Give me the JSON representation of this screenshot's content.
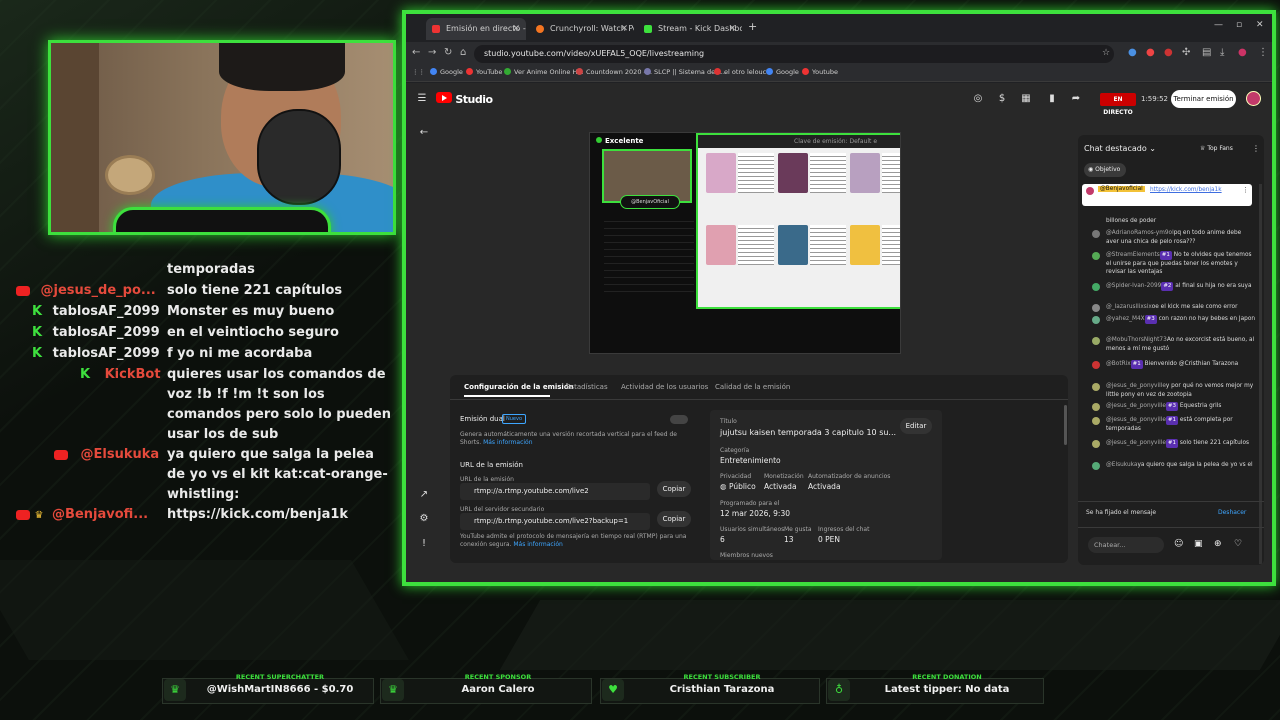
{
  "overlay_chat": [
    {
      "platform": "youtube",
      "user": "",
      "text": "temporadas",
      "user_color": "#e8e8e8"
    },
    {
      "platform": "youtube",
      "user": "@jesus_de_po...",
      "text": "solo tiene 221 capítulos",
      "user_color": "#e54a3c"
    },
    {
      "platform": "kick",
      "user": "tablosAF_2099",
      "text": "Monster es muy bueno",
      "user_color": "#e8e8e8"
    },
    {
      "platform": "kick",
      "user": "tablosAF_2099",
      "text": "en el veintiocho seguro",
      "user_color": "#e8e8e8"
    },
    {
      "platform": "kick",
      "user": "tablosAF_2099",
      "text": "f yo ni me acordaba",
      "user_color": "#e8e8e8"
    },
    {
      "platform": "kick",
      "user": "KickBot",
      "text": "quieres usar los comandos de voz !b !f !m !t son los comandos pero solo lo pueden usar los de sub",
      "user_color": "#e54a3c"
    },
    {
      "platform": "youtube",
      "user": "@Elsukuka",
      "text": "ya quiero que salga la pelea de yo vs el kit kat:cat-orange-whistling:",
      "user_color": "#e54a3c"
    },
    {
      "platform": "youtube",
      "user": "@Benjavofi...",
      "text": "https://kick.com/benja1k",
      "user_color": "#e54a3c"
    }
  ],
  "browser": {
    "tabs": [
      {
        "label": "Emisión en directo - YouTube S",
        "color": "#e33"
      },
      {
        "label": "Crunchyroll: Watch Popular An",
        "color": "#f47521"
      },
      {
        "label": "Stream - Kick Dashboard",
        "color": "#3de03d"
      }
    ],
    "url": "studio.youtube.com/video/xUEFAL5_OQE/livestreaming",
    "bookmarks": [
      "Google",
      "YouTube",
      "Ver Anime Online H...",
      "Countdown 2020 -...",
      "SLCP || Sistema de L...",
      "el otro lelouch",
      "Google",
      "Youtube"
    ]
  },
  "studio": {
    "brand": "Studio",
    "live_badge": "EN DIRECTO",
    "elapsed": "1:59:52",
    "end_button": "Terminar emisión",
    "preview_status": "Excelente",
    "stream_key_placeholder": "Clave de emisión: Default e",
    "preview_channel": "@BenjavOficial",
    "tabs": [
      "Configuración de la emisión",
      "Estadísticas",
      "Actividad de los usuarios",
      "Calidad de la emisión"
    ],
    "dual": {
      "label": "Emisión dual",
      "badge": "Nuevo",
      "desc": "Genera automáticamente una versión recortada vertical para el feed de Shorts.",
      "more": "Más información"
    },
    "url_section": "URL de la emisión",
    "url_label": "URL de la emisión",
    "url_value": "rtmp://a.rtmp.youtube.com/live2",
    "backup_label": "URL del servidor secundario",
    "backup_value": "rtmp://b.rtmp.youtube.com/live2?backup=1",
    "copy": "Copiar",
    "rtmp_note": "YouTube admite el protocolo de mensajería en tiempo real (RTMP) para una conexión segura.",
    "rtmp_more": "Más información",
    "details": {
      "title_label": "Título",
      "title": "jujutsu kaisen temporada 3 capitulo 10 su...",
      "edit": "Editar",
      "category_label": "Categoría",
      "category": "Entretenimiento",
      "privacy_label": "Privacidad",
      "privacy": "Público",
      "monet_label": "Monetización",
      "monet": "Activada",
      "auto_label": "Automatizador de anuncios",
      "auto": "Activada",
      "sched_label": "Programado para el",
      "sched": "12 mar 2026, 9:30",
      "viewers_label": "Usuarios simultáneos",
      "viewers": "6",
      "likes_label": "Me gusta",
      "likes": "13",
      "income_label": "Ingresos del chat",
      "income": "0 PEN",
      "members_label": "Miembros nuevos"
    }
  },
  "chat_panel": {
    "title": "Chat destacado",
    "top_fans": "Top Fans",
    "goal": "Objetivo",
    "pinned_user": "@Benjavoficial",
    "pinned_link": "https://kick.com/benja1k",
    "messages": [
      {
        "user": "",
        "text": "billones de poder",
        "badge": ""
      },
      {
        "user": "@AdrianoRamos-ym9ol",
        "text": "pq en todo anime debe aver una chica de pelo rosa???",
        "badge": ""
      },
      {
        "user": "@StreamElements",
        "text": "No te olvides que tenemos el unirse para que puedas tener los emotes y revisar las ventajas",
        "badge": "#1"
      },
      {
        "user": "@Spider-Ivan-2099",
        "text": "al final su hija no era suya",
        "badge": "#2"
      },
      {
        "user": "@_lazarusllixsix",
        "text": "oe el kick me sale como error",
        "badge": ""
      },
      {
        "user": "@yahez_M4X",
        "text": "con razon no hay bebes en Japon",
        "badge": "#3"
      },
      {
        "user": "@MobuThorsNight73",
        "text": "Ao no excorcist está bueno, al menos a mí me gustó",
        "badge": ""
      },
      {
        "user": "@BotRix",
        "text": "Bienvenido @Cristhian Tarazona",
        "badge": "#1"
      },
      {
        "user": "@jesus_de_ponyville",
        "text": "y por qué no vemos mejor my little pony en vez de zootopia",
        "badge": ""
      },
      {
        "user": "@jesus_de_ponyville",
        "text": "Equestria grils",
        "badge": "#3"
      },
      {
        "user": "@jesus_de_ponyville",
        "text": "está completa por temporadas",
        "badge": "#1"
      },
      {
        "user": "@jesus_de_ponyville",
        "text": "solo tiene 221 capítulos",
        "badge": "#1"
      },
      {
        "user": "@Elsukuka",
        "text": "ya quiero que salga la pelea de yo vs el",
        "badge": ""
      }
    ],
    "pinned_notice": "Se ha fijado el mensaje",
    "undo": "Deshacer",
    "input_placeholder": "Chatear..."
  },
  "bottom_bar": [
    {
      "title": "RECENT SUPERCHATTER",
      "value": "@WishMartIN8666 - $0.70"
    },
    {
      "title": "RECENT SPONSOR",
      "value": "Aaron Calero"
    },
    {
      "title": "RECENT SUBSCRIBER",
      "value": "Cristhian Tarazona"
    },
    {
      "title": "RECENT DONATION",
      "value": "Latest tipper: No data"
    }
  ]
}
